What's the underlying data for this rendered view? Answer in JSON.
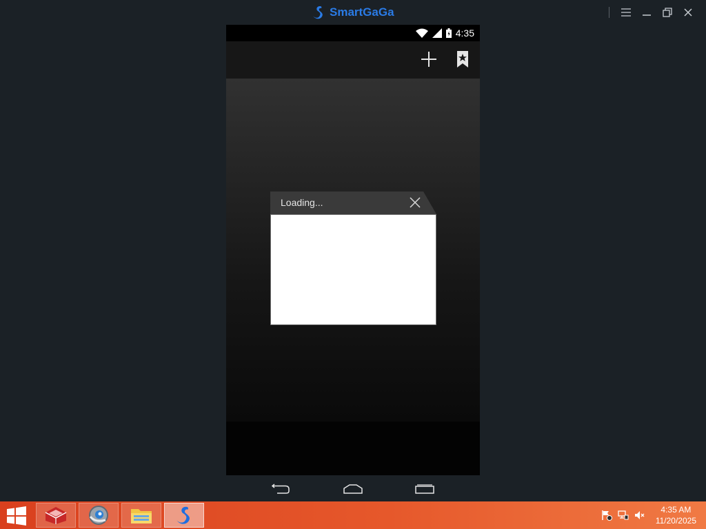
{
  "window": {
    "title": "SmartGaGa",
    "controls": [
      "menu-icon",
      "minimize-icon",
      "restore-icon",
      "close-icon"
    ]
  },
  "android": {
    "status_time": "4:35",
    "status_icons": [
      "wifi-icon",
      "signal-icon",
      "battery-icon"
    ],
    "actionbar_icons": [
      "add-icon",
      "bookmark-star-icon"
    ],
    "dialog": {
      "title": "Loading...",
      "body": ""
    },
    "nav_icons": [
      "back-icon",
      "home-icon",
      "recents-icon"
    ]
  },
  "taskbar": {
    "apps": [
      "gamecenter-app",
      "browser-app",
      "file-explorer-app",
      "smartgaga-app"
    ],
    "active_app": "smartgaga-app",
    "clock_time": "4:35 AM",
    "clock_date": "11/20/2025"
  },
  "colors": {
    "brand": "#2a7be6",
    "taskbar": "#e6582b",
    "desktop_bg": "#1b2126"
  }
}
